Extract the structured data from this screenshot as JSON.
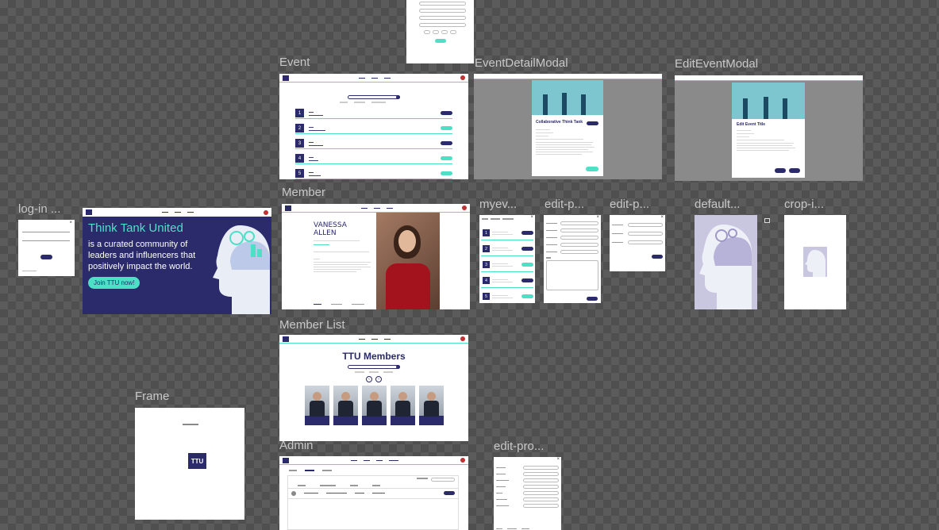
{
  "frames": {
    "event": "Event",
    "event_detail_modal": "EventDetailModal",
    "edit_event_modal": "EditEventModal",
    "log_in": "log-in ...",
    "member": "Member",
    "myev": "myev...",
    "edit_p1": "edit-p...",
    "edit_p2": "edit-p...",
    "default": "default...",
    "crop": "crop-i...",
    "member_list": "Member List",
    "frame": "Frame",
    "admin": "Admin",
    "edit_pro": "edit-pro..."
  },
  "hero": {
    "title": "Think Tank United",
    "subtitle": "is a curated community of leaders and influencers that positively impact the world.",
    "cta": "Join TTU now!"
  },
  "member": {
    "first": "VANESSA",
    "last": "ALLEN"
  },
  "member_list": {
    "title": "TTU Members"
  },
  "modal": {
    "detail_title": "Collaborative Think Tank",
    "edit_title": "Edit Event Title"
  },
  "frame_logo": "TTU",
  "colors": {
    "brand": "#2b2a6b",
    "accent": "#4de0c7",
    "canvas": "#5b5b5b"
  }
}
